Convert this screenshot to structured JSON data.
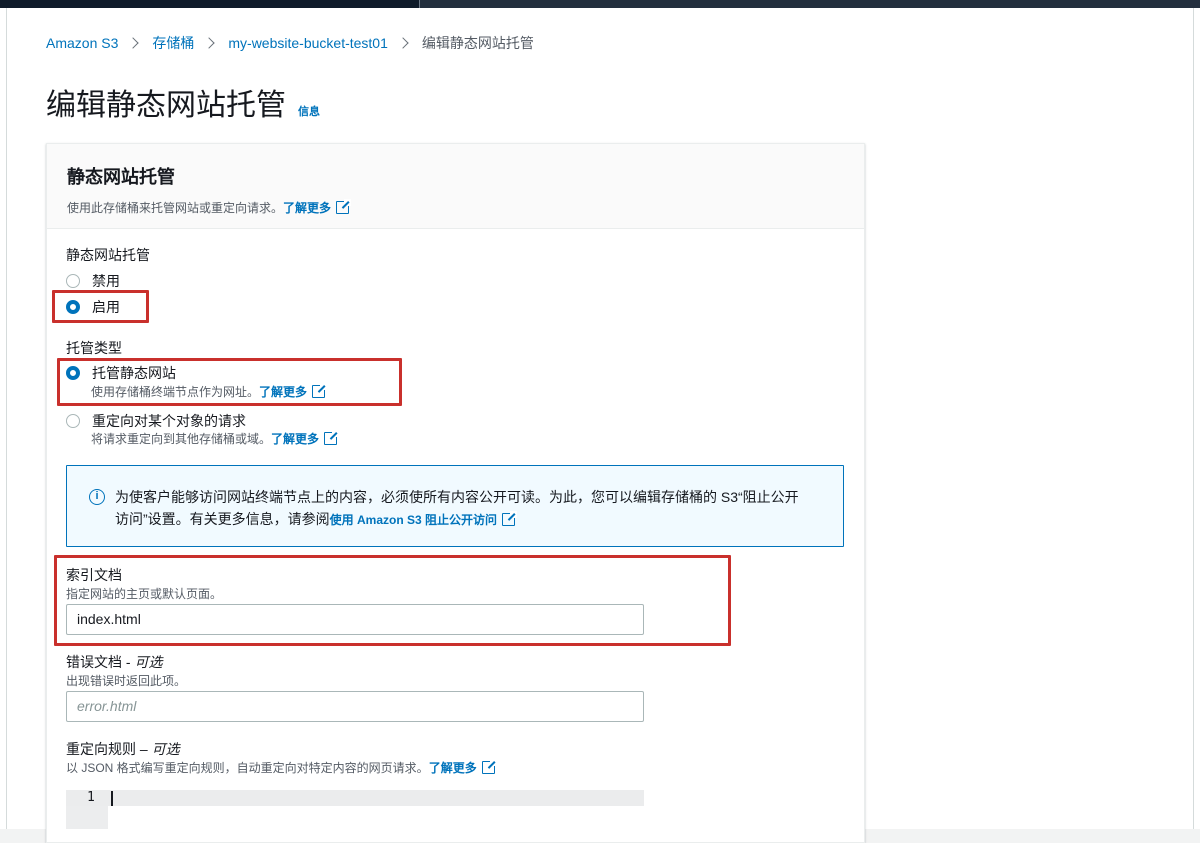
{
  "breadcrumb": {
    "items": [
      "Amazon S3",
      "存储桶",
      "my-website-bucket-test01"
    ],
    "current": "编辑静态网站托管"
  },
  "page": {
    "title": "编辑静态网站托管",
    "info": "信息"
  },
  "panel": {
    "title": "静态网站托管",
    "description": "使用此存储桶来托管网站或重定向请求。",
    "learn_more": "了解更多"
  },
  "hosting": {
    "label": "静态网站托管",
    "options": [
      {
        "label": "禁用",
        "checked": false
      },
      {
        "label": "启用",
        "checked": true
      }
    ]
  },
  "hosting_type": {
    "label": "托管类型",
    "options": [
      {
        "label": "托管静态网站",
        "description": "使用存储桶终端节点作为网址。",
        "learn_more": "了解更多",
        "checked": true
      },
      {
        "label": "重定向对某个对象的请求",
        "description": "将请求重定向到其他存储桶或域。",
        "learn_more": "了解更多",
        "checked": false
      }
    ]
  },
  "alert": {
    "line1": "为使客户能够访问网站终端节点上的内容，必须使所有内容公开可读。为此，您可以编辑存储桶的 S3“阻止公开",
    "line2": "访问”设置。有关更多信息，请参阅",
    "link": "使用 Amazon S3 阻止公开访问"
  },
  "index_document": {
    "label": "索引文档",
    "description": "指定网站的主页或默认页面。",
    "value": "index.html"
  },
  "error_document": {
    "label": "错误文档 - ",
    "optional": "可选",
    "description": "出现错误时返回此项。",
    "placeholder": "error.html"
  },
  "redirect_rules": {
    "label": "重定向规则 – ",
    "optional": "可选",
    "description": "以 JSON 格式编写重定向规则，自动重定向对特定内容的网页请求。",
    "learn_more": "了解更多",
    "line_number": "1"
  },
  "colors": {
    "link": "#0073bb",
    "highlight": "#c9302c"
  }
}
